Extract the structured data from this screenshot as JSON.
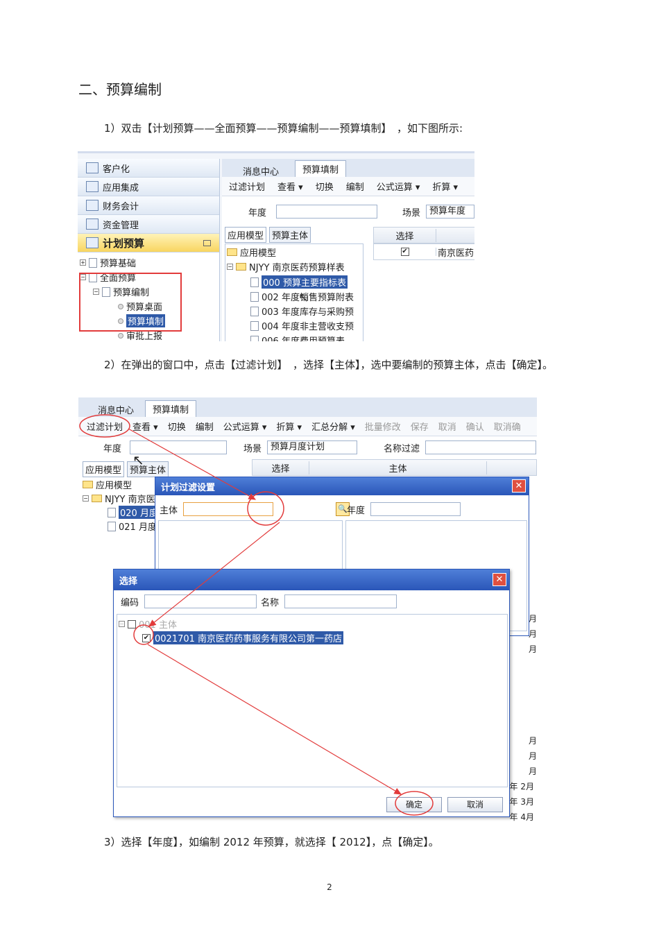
{
  "heading": "二、预算编制",
  "step1": "1）双击【计划预算——全面预算——预算编制——预算填制】　，如下图所示:",
  "step2": "2）在弹出的窗口中，点击【过滤计划】　，选择【主体】，选中要编制的预算主体，点击【确定】。",
  "step3": "3）选择【年度】，如编制 2012 年预算，就选择【 2012】，点【确定】。",
  "page_number": "2",
  "shot1": {
    "nav": [
      "客户化",
      "应用集成",
      "财务会计",
      "资金管理"
    ],
    "nav_active": "计划预算",
    "tree": {
      "budget_basic": "预算基础",
      "full_budget": "全面预算",
      "budget_compile": "预算编制",
      "budget_desktop": "预算桌面",
      "budget_fill": "预算填制",
      "approve": "审批上报"
    },
    "tabs": [
      "消息中心",
      "预算填制"
    ],
    "toolbar": [
      "过滤计划",
      "查看 ▾",
      "切换",
      "编制",
      "公式运算 ▾",
      "折算 ▾"
    ],
    "year_label": "年度",
    "scene_label": "场景",
    "scene_value": "预算年度",
    "subtabs": [
      "应用模型",
      "预算主体"
    ],
    "model_root": "应用模型",
    "model_group": "NJYY 南京医药预算样表",
    "models": [
      "000 预算主要指标表",
      "002 年度销售预算附表",
      "003 年度库存与采购预",
      "004 年度非主营收支预",
      "006 年度费用预算表"
    ],
    "grid_select": "选择",
    "grid_entity": "南京医药"
  },
  "shot2": {
    "tabs": [
      "消息中心",
      "预算填制"
    ],
    "toolbar": [
      "过滤计划",
      "查看 ▾",
      "切换",
      "编制",
      "公式运算 ▾",
      "折算 ▾",
      "汇总分解 ▾",
      "批量修改",
      "保存",
      "取消",
      "确认",
      "取消确"
    ],
    "year_label": "年度",
    "scene_label": "场景",
    "scene_value": "预算月度计划",
    "name_filter": "名称过滤",
    "subtabs": [
      "应用模型",
      "预算主体"
    ],
    "grid_cols": [
      "选择",
      "主体"
    ],
    "model_root": "应用模型",
    "model_group": "NJYY 南京医",
    "models": [
      "020 月度",
      "021 月度"
    ],
    "filter_dialog": {
      "title": "计划过滤设置",
      "entity_label": "主体",
      "year_label": "年度"
    },
    "select_dialog": {
      "title": "选择",
      "code_label": "编码",
      "name_label": "名称",
      "root": "001 主体",
      "item": "0021701 南京医药药事服务有限公司第一药店",
      "ok": "确定",
      "cancel": "取消"
    },
    "right_months": [
      "月",
      "月",
      "月",
      "月",
      "月",
      "月",
      "年 2月",
      "年 3月",
      "年 4月"
    ]
  }
}
